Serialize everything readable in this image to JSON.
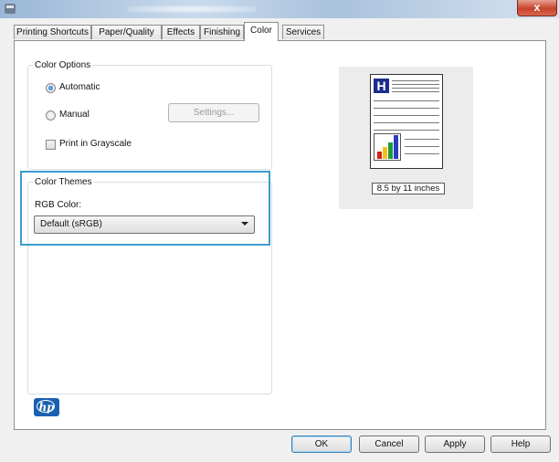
{
  "window": {
    "close_symbol": "x",
    "icon": "printer-icon"
  },
  "tabs": [
    {
      "label": "Printing Shortcuts"
    },
    {
      "label": "Paper/Quality"
    },
    {
      "label": "Effects"
    },
    {
      "label": "Finishing"
    },
    {
      "label": "Color",
      "active": true
    },
    {
      "label": "Services"
    }
  ],
  "color_options": {
    "legend": "Color Options",
    "automatic_label": "Automatic",
    "manual_label": "Manual",
    "selected": "Automatic",
    "settings_button": "Settings...",
    "grayscale_label": "Print in Grayscale",
    "grayscale_checked": false
  },
  "color_themes": {
    "legend": "Color Themes",
    "rgb_label": "RGB Color:",
    "rgb_value": "Default (sRGB)"
  },
  "preview": {
    "page_size_label": "8.5 by 11 inches",
    "heading_letter": "H"
  },
  "footer": {
    "ok": "OK",
    "cancel": "Cancel",
    "apply": "Apply",
    "help": "Help"
  },
  "logo": {
    "text": "hp"
  },
  "colors": {
    "highlight": "#3d9bd0",
    "preview_block": "#1d2d8c"
  }
}
